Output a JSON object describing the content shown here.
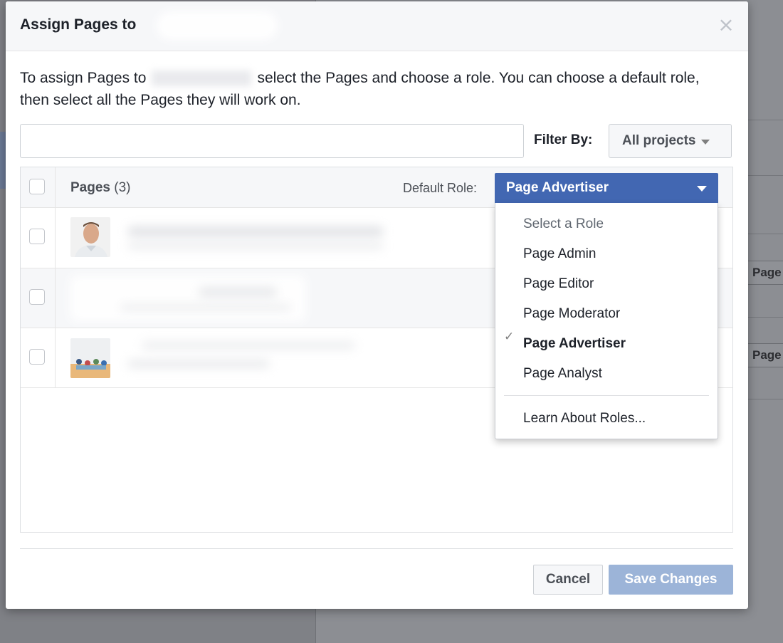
{
  "background": {
    "chip_1": "Page A",
    "chip_2": "Page A"
  },
  "dialog": {
    "title": "Assign Pages to",
    "close_icon": "close-icon",
    "description_before": "To assign Pages to",
    "description_after": "select the Pages and choose a role. You can choose a default role, then select all the Pages they will work on.",
    "search_placeholder": "",
    "filter_label": "Filter By:",
    "filter_value": "All projects"
  },
  "table": {
    "header_pages": "Pages",
    "header_count": "(3)",
    "default_role_label": "Default Role:",
    "rows": [
      {
        "thumbnail": "person-portrait"
      },
      {
        "thumbnail": "none"
      },
      {
        "thumbnail": "group-photo"
      }
    ]
  },
  "role_dropdown": {
    "selected": "Page Advertiser",
    "items": [
      {
        "label": "Select a Role",
        "type": "header"
      },
      {
        "label": "Page Admin"
      },
      {
        "label": "Page Editor"
      },
      {
        "label": "Page Moderator"
      },
      {
        "label": "Page Advertiser",
        "checked": true
      },
      {
        "label": "Page Analyst"
      }
    ],
    "learn_more": "Learn About Roles..."
  },
  "footer": {
    "cancel_label": "Cancel",
    "save_label": "Save Changes",
    "save_enabled": false
  },
  "colors": {
    "accent": "#4267b2",
    "save_disabled": "#9cb4d8"
  }
}
